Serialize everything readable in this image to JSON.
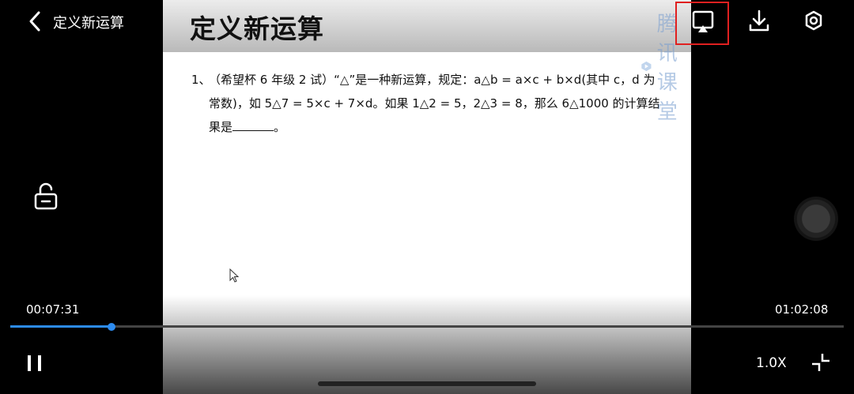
{
  "header": {
    "title": "定义新运算",
    "watermark_text": "腾讯课堂"
  },
  "slide": {
    "heading": "定义新运算",
    "problem_number": "1、",
    "problem_text": "（希望杯 6 年级 2 试）“△”是一种新运算，规定：a△b = a×c + b×d(其中 c，d 为常数)，如 5△7 = 5×c + 7×d。如果 1△2 = 5，2△3 = 8，那么 6△1000 的计算结果是",
    "problem_tail": "。"
  },
  "player": {
    "current_time": "00:07:31",
    "total_time": "01:02:08",
    "progress": 0.121,
    "speed": "1.0X"
  },
  "colors": {
    "accent": "#2d8cf0",
    "highlight": "#e02020"
  },
  "icons": [
    "back-arrow-icon",
    "cast-screen-icon",
    "download-icon",
    "settings-icon",
    "unlock-icon",
    "pause-icon",
    "exit-fullscreen-icon",
    "cursor-icon"
  ]
}
